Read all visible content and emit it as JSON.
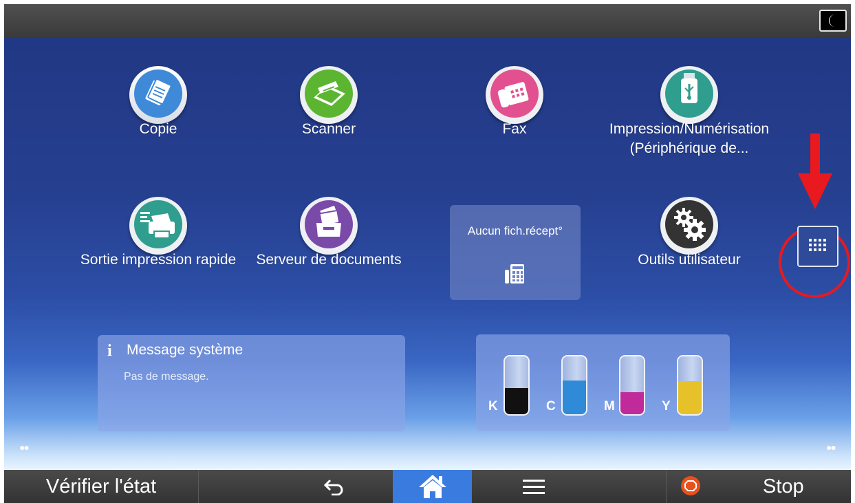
{
  "apps": [
    {
      "label": "Copie",
      "icon": "copy-icon",
      "color": "#3e8ad8"
    },
    {
      "label": "Scanner",
      "icon": "scanner-icon",
      "color": "#5cb531"
    },
    {
      "label": "Fax",
      "icon": "fax-icon",
      "color": "#e3508f"
    },
    {
      "label_line1": "Impression/Numérisation",
      "label_line2": "(Périphérique de...",
      "icon": "usb-icon",
      "color": "#2f9e8e"
    },
    {
      "label": "Sortie impression rapide",
      "icon": "quick-print-icon",
      "color": "#2f9e8e"
    },
    {
      "label": "Serveur de documents",
      "icon": "document-server-icon",
      "color": "#7a4aa8"
    },
    {
      "label": "Outils utilisateur",
      "icon": "gear-icon",
      "color": "#333333"
    }
  ],
  "fax_widget": {
    "text": "Aucun fich.récept°",
    "icon": "fax-file-icon"
  },
  "system_message": {
    "title": "Message système",
    "text": "Pas de message.",
    "icon": "info-icon"
  },
  "toner": [
    {
      "label": "K",
      "level": 0.45,
      "color": "#111111"
    },
    {
      "label": "C",
      "level": 0.58,
      "color": "#2f8ad8"
    },
    {
      "label": "M",
      "level": 0.38,
      "color": "#c02a9a"
    },
    {
      "label": "Y",
      "level": 0.57,
      "color": "#e6c12a"
    }
  ],
  "bottom_bar": {
    "check_status": "Vérifier l'état",
    "back_icon": "back-icon",
    "home_icon": "home-icon",
    "menu_icon": "menu-icon",
    "stop_icon": "stop-icon",
    "stop_label": "Stop"
  },
  "top_bar": {
    "sleep_icon": "moon-icon"
  },
  "apps_grid_icon": "app-grid-icon",
  "accent_color": "#e8191f"
}
